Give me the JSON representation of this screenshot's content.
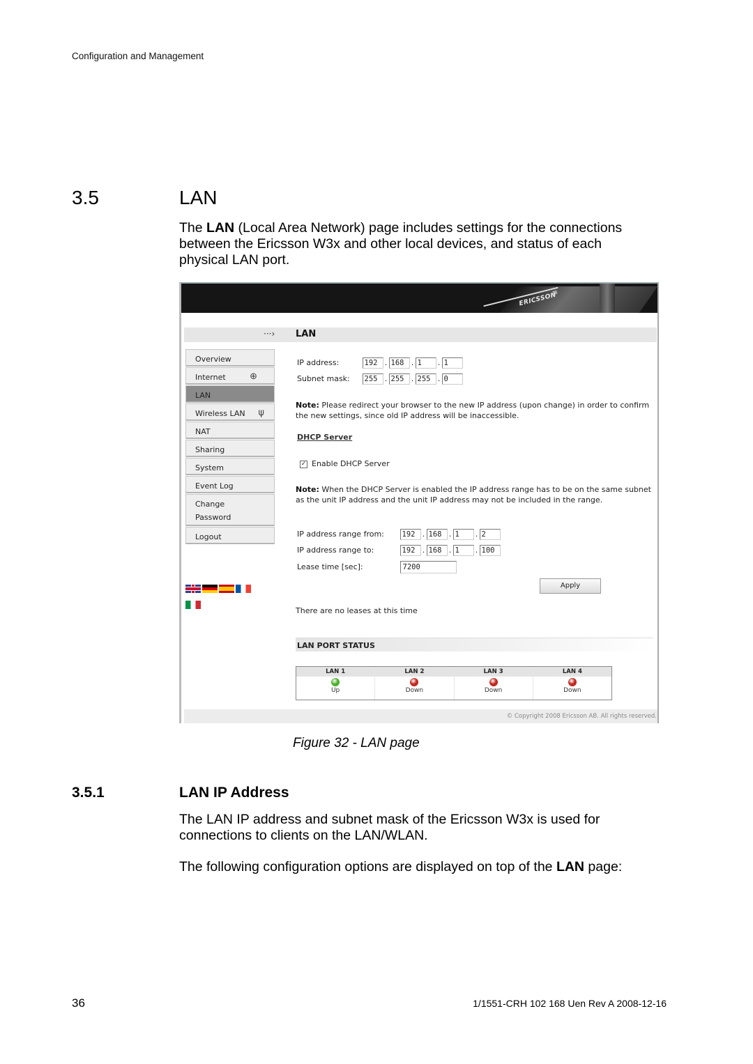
{
  "running_header": "Configuration and Management",
  "section": {
    "number": "3.5",
    "title": "LAN",
    "intro_prefix": "The ",
    "intro_bold": "LAN",
    "intro_rest": " (Local Area Network) page includes settings for the connections between the Ericsson W3x and other local devices, and status of each physical LAN port."
  },
  "screenshot": {
    "brand": "ERICSSON",
    "page_title": "LAN",
    "nav": [
      {
        "label": "Overview",
        "icon": null,
        "active": false
      },
      {
        "label": "Internet",
        "icon": "globe-icon",
        "active": false
      },
      {
        "label": "LAN",
        "icon": null,
        "active": true
      },
      {
        "label": "Wireless LAN",
        "icon": "antenna-icon",
        "active": false
      },
      {
        "label": "NAT",
        "icon": null,
        "active": false
      },
      {
        "label": "Sharing",
        "icon": null,
        "active": false
      },
      {
        "label": "System",
        "icon": null,
        "active": false
      },
      {
        "label": "Event Log",
        "icon": null,
        "active": false
      },
      {
        "label": "Change Password",
        "icon": null,
        "active": false
      },
      {
        "label": "Logout",
        "icon": null,
        "active": false
      }
    ],
    "languages": [
      "English",
      "German",
      "Spanish",
      "French",
      "Italian"
    ],
    "ip_address": {
      "label": "IP address:",
      "octets": [
        "192",
        "168",
        "1",
        "1"
      ]
    },
    "subnet_mask": {
      "label": "Subnet mask:",
      "octets": [
        "255",
        "255",
        "255",
        "0"
      ]
    },
    "note1": {
      "bold": "Note:",
      "text": " Please redirect your browser to the new IP address (upon change) in order to confirm the new settings, since old IP address will be inaccessible."
    },
    "dhcp_heading": "DHCP Server",
    "dhcp_enable": {
      "label": "Enable DHCP Server",
      "checked": true
    },
    "note2": {
      "bold": "Note:",
      "text": " When the DHCP Server is enabled the IP address range has to be on the same subnet as the unit IP address and the unit IP address may not be included in the range."
    },
    "range_from": {
      "label": "IP address range from:",
      "octets": [
        "192",
        "168",
        "1",
        "2"
      ]
    },
    "range_to": {
      "label": "IP address range to:",
      "octets": [
        "192",
        "168",
        "1",
        "100"
      ]
    },
    "lease_time": {
      "label": "Lease time [sec]:",
      "value": "7200"
    },
    "apply_label": "Apply",
    "no_leases": "There are no leases at this time",
    "port_status_heading": "LAN PORT STATUS",
    "ports": [
      {
        "name": "LAN 1",
        "status": "Up",
        "color": "#4caf2a"
      },
      {
        "name": "LAN 2",
        "status": "Down",
        "color": "#c0281e"
      },
      {
        "name": "LAN 3",
        "status": "Down",
        "color": "#c0281e"
      },
      {
        "name": "LAN 4",
        "status": "Down",
        "color": "#c0281e"
      }
    ],
    "copyright": "© Copyright 2008 Ericsson AB. All rights reserved."
  },
  "caption": "Figure 32 - LAN page",
  "subsection": {
    "number": "3.5.1",
    "title": "LAN IP Address",
    "para1": "The LAN IP address and subnet mask of the Ericsson W3x is used for connections to clients on the LAN/WLAN.",
    "para2_prefix": "The following configuration options are displayed on top of the ",
    "para2_bold": "LAN",
    "para2_suffix": " page:"
  },
  "footer": {
    "page_number": "36",
    "doc_id": "1/1551-CRH 102 168 Uen Rev A  2008-12-16"
  }
}
